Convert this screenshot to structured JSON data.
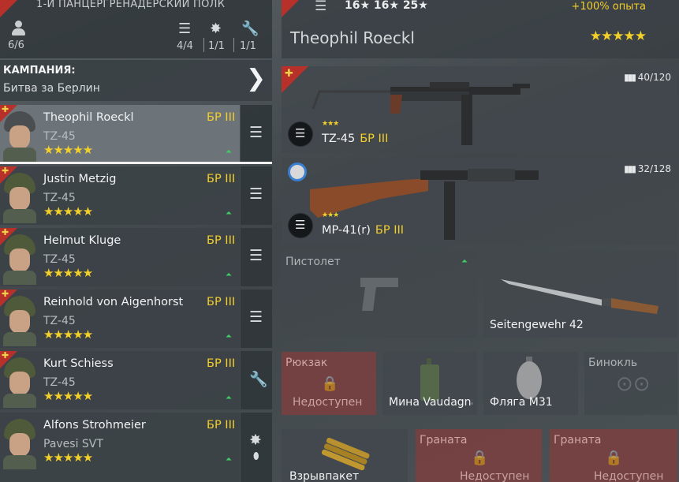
{
  "squad": {
    "title": "1-Й ПАНЦЕРГРЕНАДЕРСКИЙ ПОЛК",
    "count": "6/6",
    "stats": [
      {
        "icon": "list-icon",
        "value": "4/4"
      },
      {
        "icon": "burst-icon",
        "value": "1/1"
      },
      {
        "icon": "wrench-icon",
        "value": "1/1"
      }
    ]
  },
  "campaign": {
    "label": "КАМПАНИЯ:",
    "name": "Битва за Берлин",
    "arrow": "❯"
  },
  "soldiers": [
    {
      "name": "Theophil Roeckl",
      "weapon": "TZ-45",
      "br": "БР III",
      "stars": "★★★★★",
      "side_icon": "list-icon",
      "glyph": "☰"
    },
    {
      "name": "Justin Metzig",
      "weapon": "TZ-45",
      "br": "БР III",
      "stars": "★★★★★",
      "side_icon": "list-icon",
      "glyph": "☰"
    },
    {
      "name": "Helmut Kluge",
      "weapon": "TZ-45",
      "br": "БР III",
      "stars": "★★★★★",
      "side_icon": "list-icon",
      "glyph": "☰"
    },
    {
      "name": "Reinhold von Aigenhorst",
      "weapon": "TZ-45",
      "br": "БР III",
      "stars": "★★★★★",
      "side_icon": "list-icon",
      "glyph": "☰"
    },
    {
      "name": "Kurt Schiess",
      "weapon": "TZ-45",
      "br": "БР III",
      "stars": "★★★★★",
      "side_icon": "wrench-icon",
      "glyph": "🔧"
    },
    {
      "name": "Alfons Strohmeier",
      "weapon": "Pavesi SVT",
      "br": "БР III",
      "stars": "★★★★★",
      "side_icon": "burst-icon",
      "glyph": "✸"
    }
  ],
  "soldier_header": {
    "stats": "16★ 16★ 25★",
    "exp_bonus": "+100% опыта",
    "name": "Theophil Roeckl",
    "stars": "★★★★★"
  },
  "primary": {
    "name": "TZ-45",
    "br": "БР III",
    "stars": "★★★",
    "ammo": "40/120"
  },
  "secondary": {
    "name": "MP-41(r)",
    "br": "БР III",
    "stars": "★★★",
    "ammo": "32/128"
  },
  "pistol_slot": {
    "title": "Пистолет"
  },
  "melee_slot": {
    "name": "Seitengewehr 42"
  },
  "items": [
    {
      "title": "Рюкзак",
      "status": "Недоступен"
    },
    {
      "name": "Мина Vaudagna"
    },
    {
      "name": "Фляга M31"
    },
    {
      "title": "Бинокль"
    }
  ],
  "grenades": [
    {
      "name": "Взрывпакет"
    },
    {
      "title": "Граната",
      "status": "Недоступен"
    },
    {
      "title": "Граната",
      "status": "Недоступен"
    }
  ],
  "colors": {
    "accent": "#f3cf2a",
    "upgrade": "#3fce63",
    "locked": "#803e3e",
    "badge": "#b8302a"
  }
}
